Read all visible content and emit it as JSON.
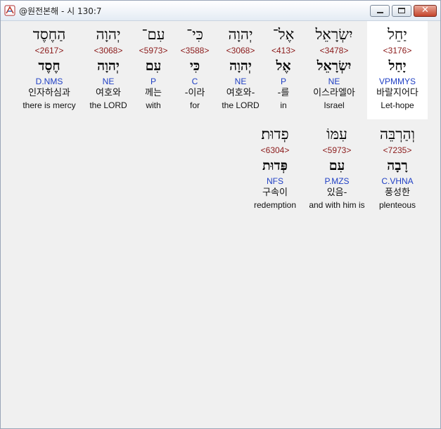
{
  "window": {
    "title": "@원전본해 - 시 130:7"
  },
  "words": [
    {
      "hebrew": "יַחֵל",
      "strong": "<3176>",
      "lemma": "יָחַל",
      "parse": "VPMMYS",
      "korean": "바랄지어다",
      "english": "Let-hope",
      "selected": true
    },
    {
      "hebrew": "יִשְׂרָאֵל",
      "strong": "<3478>",
      "lemma": "יִשְׂרָאֵל",
      "parse": "NE",
      "korean": "이스라엘아",
      "english": "Israel"
    },
    {
      "hebrew": "אֶל־",
      "strong": "<413>",
      "lemma": "אֶל",
      "parse": "P",
      "korean": "-를",
      "english": "in"
    },
    {
      "hebrew": "יְהוָה",
      "strong": "<3068>",
      "lemma": "יְהוָה",
      "parse": "NE",
      "korean": "여호와-",
      "english": "the LORD"
    },
    {
      "hebrew": "כִּי־",
      "strong": "<3588>",
      "lemma": "כִּי",
      "parse": "C",
      "korean": "-이라",
      "english": "for"
    },
    {
      "hebrew": "עִם־",
      "strong": "<5973>",
      "lemma": "עִם",
      "parse": "P",
      "korean": "께는",
      "english": "with"
    },
    {
      "hebrew": "יְהוָה",
      "strong": "<3068>",
      "lemma": "יְהוָה",
      "parse": "NE",
      "korean": "여호와",
      "english": "the LORD"
    },
    {
      "hebrew": "הַחֶסֶד",
      "strong": "<2617>",
      "lemma": "חֶסֶד",
      "parse": "D.NMS",
      "korean": "인자하심과",
      "english": "there is mercy"
    },
    {
      "hebrew": "וְהַרְבֵּה",
      "strong": "<7235>",
      "lemma": "רָבָה",
      "parse": "C.VHNA",
      "korean": "풍성한",
      "english": "plenteous"
    },
    {
      "hebrew": "עִמּוֹ",
      "strong": "<5973>",
      "lemma": "עִם",
      "parse": "P.MZS",
      "korean": "있음-",
      "english": "and with him is"
    },
    {
      "hebrew": "פְדוּת׃",
      "strong": "<6304>",
      "lemma": "פְּדוּת",
      "parse": "NFS",
      "korean": "구속이",
      "english": "redemption"
    }
  ]
}
